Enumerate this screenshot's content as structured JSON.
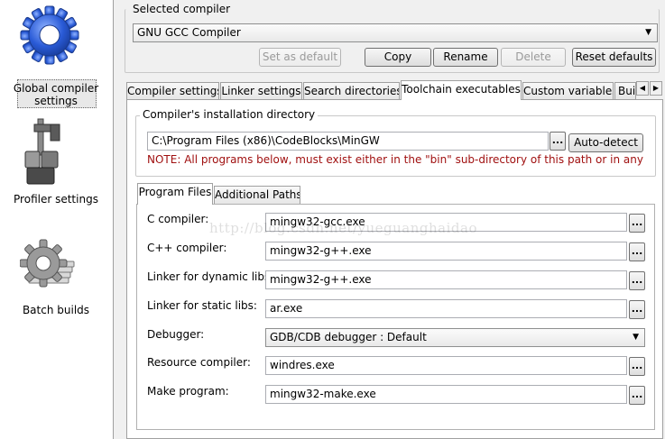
{
  "sidebar": {
    "items": [
      {
        "label": "Global compiler settings",
        "icon": "gear-icon",
        "selected": true
      },
      {
        "label": "Profiler settings",
        "icon": "caliper-icon",
        "selected": false
      },
      {
        "label": "Batch builds",
        "icon": "batch-gear-icon",
        "selected": false
      }
    ]
  },
  "compiler": {
    "label": "Selected compiler",
    "selected": "GNU GCC Compiler",
    "buttons": {
      "set_default": "Set as default",
      "copy": "Copy",
      "rename": "Rename",
      "delete": "Delete",
      "reset": "Reset defaults"
    }
  },
  "tabs": {
    "items": [
      "Compiler settings",
      "Linker settings",
      "Search directories",
      "Toolchain executables",
      "Custom variables",
      "Bui"
    ],
    "active": "Toolchain executables"
  },
  "install_dir": {
    "label": "Compiler's installation directory",
    "value": "C:\\Program Files (x86)\\CodeBlocks\\MinGW",
    "browse": "...",
    "auto_detect": "Auto-detect",
    "note": "NOTE: All programs below, must exist either in the \"bin\" sub-directory of this path or in any of the"
  },
  "subtabs": {
    "items": [
      "Program Files",
      "Additional Paths"
    ],
    "active": "Program Files"
  },
  "programs": {
    "c_label": "C compiler:",
    "c_value": "mingw32-gcc.exe",
    "cpp_label": "C++ compiler:",
    "cpp_value": "mingw32-g++.exe",
    "dyn_label": "Linker for dynamic libs:",
    "dyn_value": "mingw32-g++.exe",
    "static_label": "Linker for static libs:",
    "static_value": "ar.exe",
    "debugger_label": "Debugger:",
    "debugger_value": "GDB/CDB debugger : Default",
    "res_label": "Resource compiler:",
    "res_value": "windres.exe",
    "make_label": "Make program:",
    "make_value": "mingw32-make.exe",
    "browse": "..."
  },
  "watermark": "http://blog.csdn.net/yueguanghaidao",
  "colors": {
    "gear_blue": "#2a5bd7",
    "note_red": "#a01010"
  }
}
